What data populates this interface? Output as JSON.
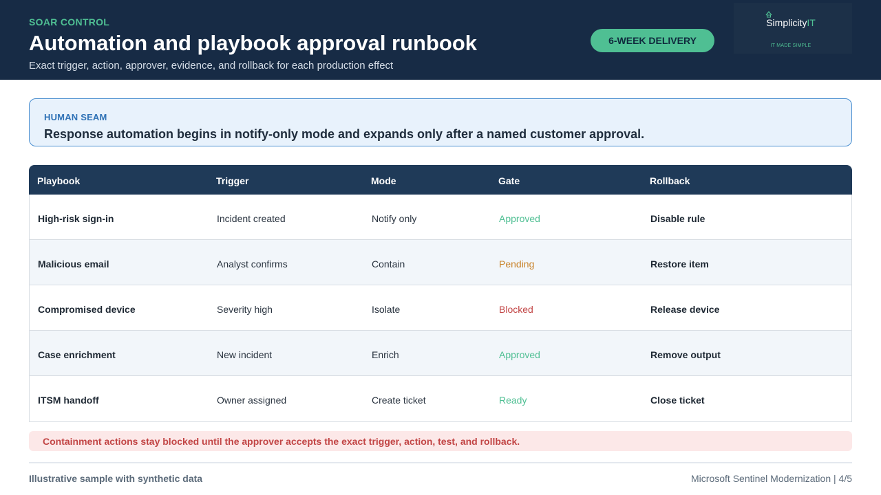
{
  "header": {
    "eyebrow": "SOAR CONTROL",
    "title": "Automation and playbook approval runbook",
    "subtitle": "Exact trigger, action, approver, evidence, and rollback for each production effect",
    "pill": "6-WEEK DELIVERY"
  },
  "logo": {
    "icon": "cloud-icon",
    "word_main": "Simplicity",
    "word_accent": "IT",
    "tagline": "IT MADE SIMPLE"
  },
  "callout": {
    "label": "HUMAN SEAM",
    "text": "Response automation begins in notify-only mode and expands only after a named customer approval."
  },
  "table": {
    "headers": [
      "Playbook",
      "Trigger",
      "Mode",
      "Gate",
      "Rollback"
    ],
    "rows": [
      {
        "playbook": "High-risk sign-in",
        "trigger": "Incident created",
        "mode": "Notify only",
        "gate": "Approved",
        "rollback": "Disable rule"
      },
      {
        "playbook": "Malicious email",
        "trigger": "Analyst confirms",
        "mode": "Contain",
        "gate": "Pending",
        "rollback": "Restore item"
      },
      {
        "playbook": "Compromised device",
        "trigger": "Severity high",
        "mode": "Isolate",
        "gate": "Blocked",
        "rollback": "Release device"
      },
      {
        "playbook": "Case enrichment",
        "trigger": "New incident",
        "mode": "Enrich",
        "gate": "Approved",
        "rollback": "Remove output"
      },
      {
        "playbook": "ITSM handoff",
        "trigger": "Owner assigned",
        "mode": "Create ticket",
        "gate": "Ready",
        "rollback": "Close ticket"
      }
    ]
  },
  "gate_colors": {
    "Approved": "#4fbf93",
    "Ready": "#4fbf93",
    "Pending": "#c9832a",
    "Blocked": "#c24545"
  },
  "warning": "Containment actions stay blocked until the approver accepts the exact trigger, action, test, and rollback.",
  "footer": {
    "left": "Illustrative sample with synthetic data",
    "right": "Microsoft Sentinel Modernization | 4/5"
  }
}
